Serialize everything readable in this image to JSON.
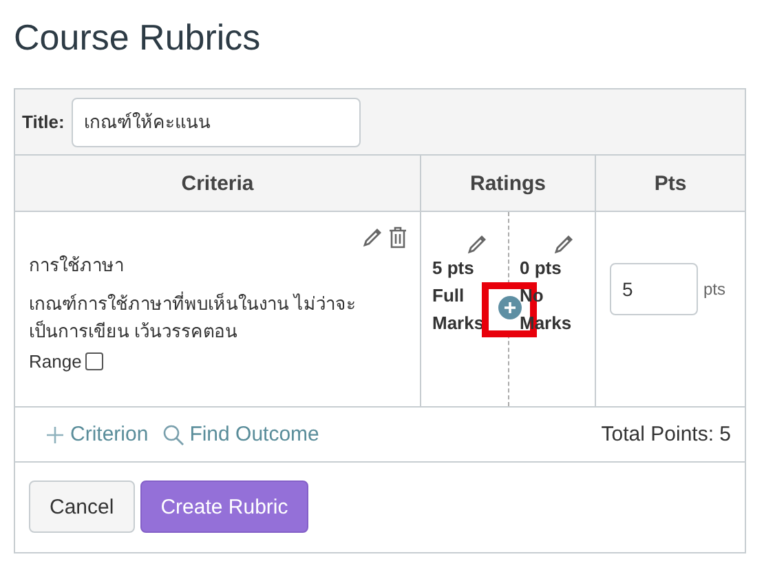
{
  "page_title": "Course Rubrics",
  "title_field": {
    "label": "Title:",
    "value": "เกณฑ์ให้คะแนน"
  },
  "columns": [
    "Criteria",
    "Ratings",
    "Pts"
  ],
  "criteria": [
    {
      "name": "การใช้ภาษา",
      "description": "เกณฑ์การใช้ภาษาที่พบเห็นในงาน ไม่ว่าจะเป็นการเขียน เว้นวรรคตอน",
      "range_label": "Range",
      "range_checked": false,
      "ratings": [
        {
          "points": "5 pts",
          "description": "Full Marks"
        },
        {
          "points": "0 pts",
          "description": "No Marks"
        }
      ],
      "add_rating_highlighted": true,
      "points_value": "5",
      "points_unit": "pts"
    }
  ],
  "actions": [
    {
      "kind": "add",
      "label": "Criterion"
    },
    {
      "kind": "search",
      "label": "Find Outcome"
    }
  ],
  "total": "Total Points: 5",
  "buttons": [
    {
      "label": "Cancel",
      "kind": "secondary"
    },
    {
      "label": "Create Rubric",
      "kind": "primary"
    }
  ]
}
